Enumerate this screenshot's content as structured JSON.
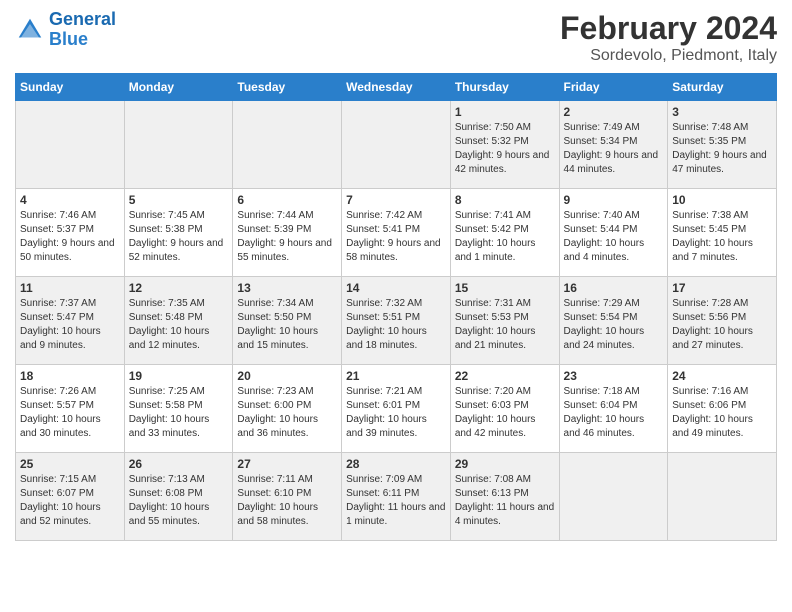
{
  "header": {
    "logo_line1": "General",
    "logo_line2": "Blue",
    "title": "February 2024",
    "subtitle": "Sordevolo, Piedmont, Italy"
  },
  "weekdays": [
    "Sunday",
    "Monday",
    "Tuesday",
    "Wednesday",
    "Thursday",
    "Friday",
    "Saturday"
  ],
  "weeks": [
    [
      {
        "day": "",
        "info": ""
      },
      {
        "day": "",
        "info": ""
      },
      {
        "day": "",
        "info": ""
      },
      {
        "day": "",
        "info": ""
      },
      {
        "day": "1",
        "info": "Sunrise: 7:50 AM\nSunset: 5:32 PM\nDaylight: 9 hours\nand 42 minutes."
      },
      {
        "day": "2",
        "info": "Sunrise: 7:49 AM\nSunset: 5:34 PM\nDaylight: 9 hours\nand 44 minutes."
      },
      {
        "day": "3",
        "info": "Sunrise: 7:48 AM\nSunset: 5:35 PM\nDaylight: 9 hours\nand 47 minutes."
      }
    ],
    [
      {
        "day": "4",
        "info": "Sunrise: 7:46 AM\nSunset: 5:37 PM\nDaylight: 9 hours\nand 50 minutes."
      },
      {
        "day": "5",
        "info": "Sunrise: 7:45 AM\nSunset: 5:38 PM\nDaylight: 9 hours\nand 52 minutes."
      },
      {
        "day": "6",
        "info": "Sunrise: 7:44 AM\nSunset: 5:39 PM\nDaylight: 9 hours\nand 55 minutes."
      },
      {
        "day": "7",
        "info": "Sunrise: 7:42 AM\nSunset: 5:41 PM\nDaylight: 9 hours\nand 58 minutes."
      },
      {
        "day": "8",
        "info": "Sunrise: 7:41 AM\nSunset: 5:42 PM\nDaylight: 10 hours\nand 1 minute."
      },
      {
        "day": "9",
        "info": "Sunrise: 7:40 AM\nSunset: 5:44 PM\nDaylight: 10 hours\nand 4 minutes."
      },
      {
        "day": "10",
        "info": "Sunrise: 7:38 AM\nSunset: 5:45 PM\nDaylight: 10 hours\nand 7 minutes."
      }
    ],
    [
      {
        "day": "11",
        "info": "Sunrise: 7:37 AM\nSunset: 5:47 PM\nDaylight: 10 hours\nand 9 minutes."
      },
      {
        "day": "12",
        "info": "Sunrise: 7:35 AM\nSunset: 5:48 PM\nDaylight: 10 hours\nand 12 minutes."
      },
      {
        "day": "13",
        "info": "Sunrise: 7:34 AM\nSunset: 5:50 PM\nDaylight: 10 hours\nand 15 minutes."
      },
      {
        "day": "14",
        "info": "Sunrise: 7:32 AM\nSunset: 5:51 PM\nDaylight: 10 hours\nand 18 minutes."
      },
      {
        "day": "15",
        "info": "Sunrise: 7:31 AM\nSunset: 5:53 PM\nDaylight: 10 hours\nand 21 minutes."
      },
      {
        "day": "16",
        "info": "Sunrise: 7:29 AM\nSunset: 5:54 PM\nDaylight: 10 hours\nand 24 minutes."
      },
      {
        "day": "17",
        "info": "Sunrise: 7:28 AM\nSunset: 5:56 PM\nDaylight: 10 hours\nand 27 minutes."
      }
    ],
    [
      {
        "day": "18",
        "info": "Sunrise: 7:26 AM\nSunset: 5:57 PM\nDaylight: 10 hours\nand 30 minutes."
      },
      {
        "day": "19",
        "info": "Sunrise: 7:25 AM\nSunset: 5:58 PM\nDaylight: 10 hours\nand 33 minutes."
      },
      {
        "day": "20",
        "info": "Sunrise: 7:23 AM\nSunset: 6:00 PM\nDaylight: 10 hours\nand 36 minutes."
      },
      {
        "day": "21",
        "info": "Sunrise: 7:21 AM\nSunset: 6:01 PM\nDaylight: 10 hours\nand 39 minutes."
      },
      {
        "day": "22",
        "info": "Sunrise: 7:20 AM\nSunset: 6:03 PM\nDaylight: 10 hours\nand 42 minutes."
      },
      {
        "day": "23",
        "info": "Sunrise: 7:18 AM\nSunset: 6:04 PM\nDaylight: 10 hours\nand 46 minutes."
      },
      {
        "day": "24",
        "info": "Sunrise: 7:16 AM\nSunset: 6:06 PM\nDaylight: 10 hours\nand 49 minutes."
      }
    ],
    [
      {
        "day": "25",
        "info": "Sunrise: 7:15 AM\nSunset: 6:07 PM\nDaylight: 10 hours\nand 52 minutes."
      },
      {
        "day": "26",
        "info": "Sunrise: 7:13 AM\nSunset: 6:08 PM\nDaylight: 10 hours\nand 55 minutes."
      },
      {
        "day": "27",
        "info": "Sunrise: 7:11 AM\nSunset: 6:10 PM\nDaylight: 10 hours\nand 58 minutes."
      },
      {
        "day": "28",
        "info": "Sunrise: 7:09 AM\nSunset: 6:11 PM\nDaylight: 11 hours\nand 1 minute."
      },
      {
        "day": "29",
        "info": "Sunrise: 7:08 AM\nSunset: 6:13 PM\nDaylight: 11 hours\nand 4 minutes."
      },
      {
        "day": "",
        "info": ""
      },
      {
        "day": "",
        "info": ""
      }
    ]
  ]
}
